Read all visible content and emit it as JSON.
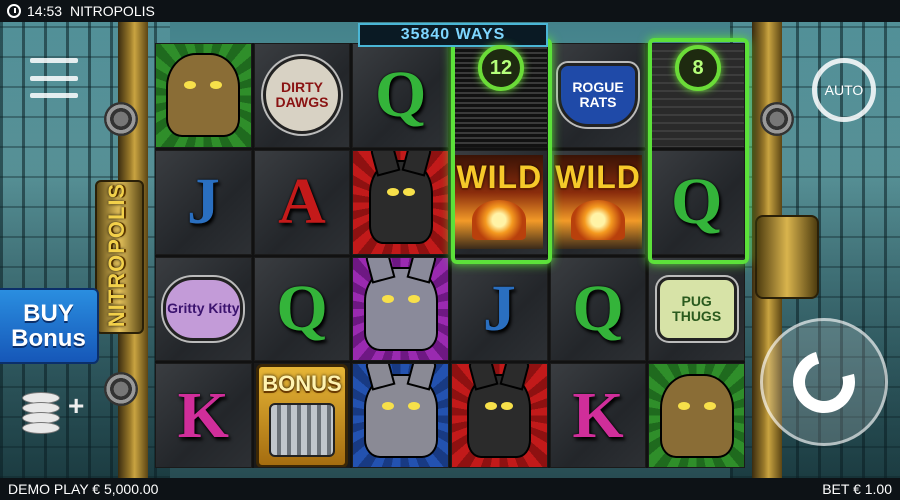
{
  "status_bar": {
    "time": "14:53",
    "title": "NITROPOLIS"
  },
  "footer": {
    "balance": "DEMO PLAY € 5,000.00",
    "bet": "BET € 1.00"
  },
  "ways": "35840 WAYS",
  "logo": "NITROPOLIS",
  "buy_bonus": {
    "line1": "BUY",
    "line2": "Bonus"
  },
  "auto_label": "AUTO",
  "multipliers": {
    "reel4": "12",
    "reel6": "8"
  },
  "colors": {
    "accent_green": "#5ce13a",
    "buy_blue": "#1f7ad0",
    "ways_cyan": "#7ed6ff"
  },
  "grid": [
    [
      {
        "kind": "char",
        "sym": "toad",
        "bg": "green"
      },
      {
        "kind": "badge",
        "text": "DIRTY DAWGS",
        "style": "dawgs"
      },
      {
        "kind": "letter",
        "text": "Q"
      },
      {
        "kind": "stripes"
      },
      {
        "kind": "badge",
        "text": "ROGUE RATS",
        "style": "rats"
      },
      {
        "kind": "stripes-light"
      }
    ],
    [
      {
        "kind": "letter",
        "text": "J"
      },
      {
        "kind": "letter",
        "text": "A"
      },
      {
        "kind": "char",
        "sym": "dog",
        "bg": "red"
      },
      {
        "kind": "wild",
        "text": "WILD"
      },
      {
        "kind": "wild",
        "text": "WILD"
      },
      {
        "kind": "letter",
        "text": "Q"
      }
    ],
    [
      {
        "kind": "badge",
        "text": "Gritty Kitty",
        "style": "kitty"
      },
      {
        "kind": "letter",
        "text": "Q"
      },
      {
        "kind": "char",
        "sym": "cat",
        "bg": "purple"
      },
      {
        "kind": "letter",
        "text": "J"
      },
      {
        "kind": "letter",
        "text": "Q"
      },
      {
        "kind": "badge",
        "text": "PUG THUGS",
        "style": "pug"
      }
    ],
    [
      {
        "kind": "letter",
        "text": "K"
      },
      {
        "kind": "bonus",
        "text": "BONUS"
      },
      {
        "kind": "char",
        "sym": "rat",
        "bg": "blue"
      },
      {
        "kind": "char",
        "sym": "dog",
        "bg": "red"
      },
      {
        "kind": "letter",
        "text": "K"
      },
      {
        "kind": "char",
        "sym": "toad",
        "bg": "green"
      }
    ]
  ]
}
